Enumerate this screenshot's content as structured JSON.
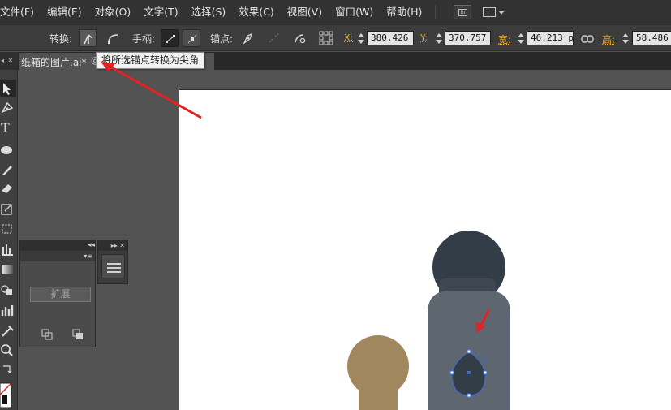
{
  "menu": {
    "items": [
      "文件(F)",
      "编辑(E)",
      "对象(O)",
      "文字(T)",
      "选择(S)",
      "效果(C)",
      "视图(V)",
      "窗口(W)",
      "帮助(H)"
    ],
    "bridge_button": "Br"
  },
  "control_bar": {
    "convert_label": "转换:",
    "handles_label": "手柄:",
    "anchor_label": "锚点:",
    "x_label": "X:",
    "y_label": "Y:",
    "width_label": "宽:",
    "height_label": "高:",
    "x_value": "380.426 p",
    "y_value": "370.757 p",
    "width_value": "46.213 pt",
    "height_value": "58.486"
  },
  "document_tab": {
    "title": "纸箱的图片.ai*",
    "close_glyph": "@"
  },
  "tooltip": {
    "text": "将所选锚点转换为尖角"
  },
  "tools": {
    "header_glyph": "◂ ✕",
    "type_tool_glyph": "T"
  },
  "floating_panel": {
    "expand_button": "扩展"
  },
  "colors": {
    "menubar_bg": "#323232",
    "control_bg": "#3c3c3c",
    "accent_label": "#e8a83a",
    "figure_dark": "#333d47",
    "figure_body": "#5e6670",
    "figure_brown": "#a0875e",
    "annotation_red": "#e52222",
    "selection_blue": "#3b6dd8"
  },
  "icons": [
    "pointer-icon",
    "convert-corner-icon",
    "convert-smooth-icon",
    "hide-handles-icon",
    "show-handles-icon",
    "pen-anchor-icon",
    "remove-anchor-icon",
    "cut-path-icon",
    "align-grid-icon",
    "link-icon"
  ]
}
